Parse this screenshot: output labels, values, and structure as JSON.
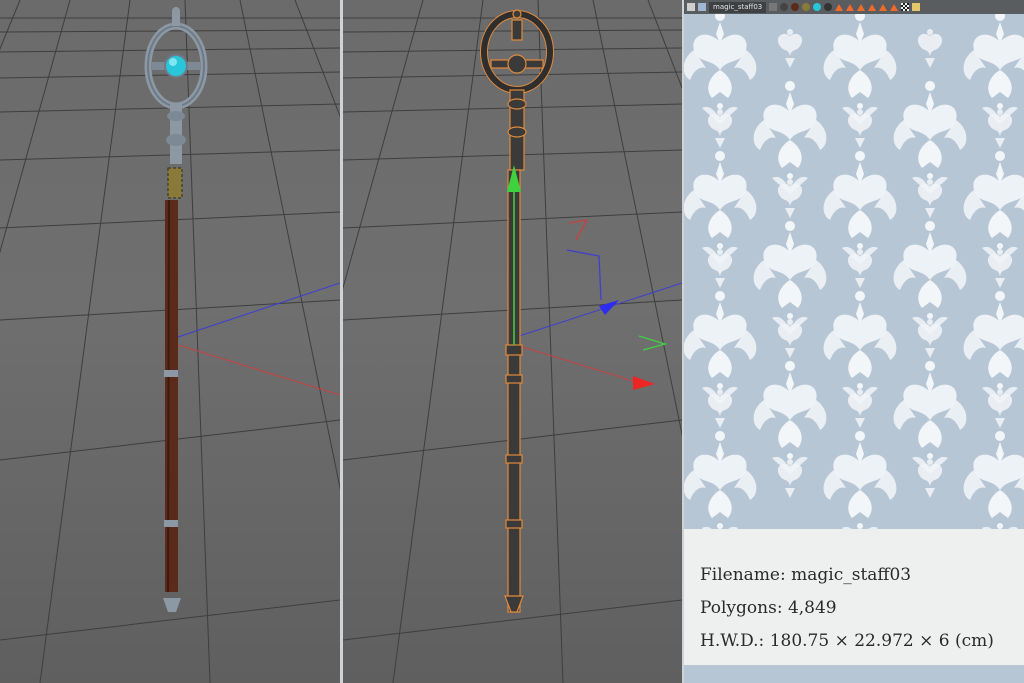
{
  "app": {
    "title": "",
    "panel": {
      "tab_label": "magic_staff03",
      "toolbar_icons": [
        "layout-icon",
        "camera-icon",
        "sphere-icon",
        "sphere-icon",
        "sphere-icon",
        "sphere-icon",
        "sphere-icon",
        "cone-icon",
        "cone-icon",
        "cone-icon",
        "cone-icon",
        "cone-icon",
        "cone-icon",
        "checker-icon",
        "render-icon"
      ]
    }
  },
  "viewports": {
    "left": {
      "mode": "textured",
      "object": "magic-staff"
    },
    "right": {
      "mode": "wireframe-selected",
      "object": "magic-staff"
    }
  },
  "colors": {
    "viewport_bg": "#6b6b6b",
    "grid": "#3c3c3c",
    "axis_x": "#c84040",
    "axis_z": "#4040c8",
    "axis_y_green": "#3fd23f",
    "selection_orange": "#e08a3c",
    "gem_cyan": "#28c6d8",
    "staff_metal": "#8a97a3",
    "staff_wood": "#5a2a1a",
    "pattern_bg": "#b7c6d5",
    "pattern_fg": "#f3f6f9",
    "info_bg": "#eef0ef"
  },
  "info": {
    "filename": "Filename: magic_staff03",
    "polygons": "Polygons: 4,849",
    "dimensions": "H.W.D.: 180.75 × 22.972 × 6 (cm)"
  }
}
